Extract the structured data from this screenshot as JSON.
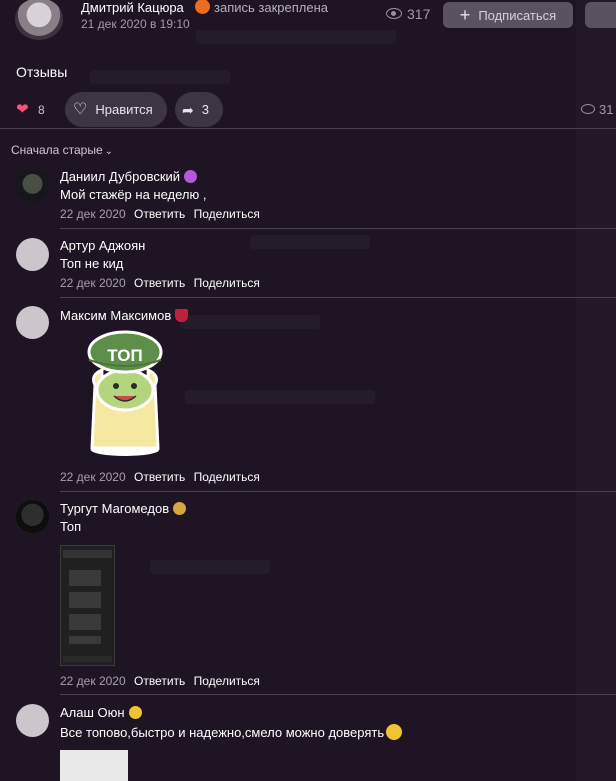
{
  "header": {
    "author_name": "Дмитрий Кацюра",
    "pinned_text": "запись закреплена",
    "date": "21 дек 2020 в 19:10",
    "views": "317",
    "subscribe_label": "Подписаться"
  },
  "post": {
    "text": "Отзывы",
    "likes": "8",
    "like_label": "Нравится",
    "shares": "3",
    "views": "31"
  },
  "sort_label": "Сначала старые",
  "comments": [
    {
      "name": "Даниил Дубровский",
      "badge": "purple-orb-icon",
      "text": "Мой стажёр на неделю ,",
      "date": "22 дек 2020",
      "reply": "Ответить",
      "share": "Поделиться"
    },
    {
      "name": "Артур Аджоян",
      "text": "Топ не кид",
      "date": "22 дек 2020",
      "reply": "Ответить",
      "share": "Поделиться"
    },
    {
      "name": "Максим Максимов",
      "badge": "wine-glass-icon",
      "sticker_text": "ТОП",
      "date": "22 дек 2020",
      "reply": "Ответить",
      "share": "Поделиться"
    },
    {
      "name": "Тургут Магомедов",
      "badge": "money-bag-icon",
      "text": "Топ",
      "date": "22 дек 2020",
      "reply": "Ответить",
      "share": "Поделиться"
    },
    {
      "name": "Алаш Оюн",
      "badge": "cowboy-emoji-icon",
      "text": "Все топово,быстро и надежно,смело можно доверять",
      "badge2": "sunglasses-emoji-icon"
    }
  ],
  "colors": {
    "background": "#1e1424",
    "button_bg": "#3e3544",
    "heart": "#ff4f7a",
    "muted_text": "#a8a0ad"
  }
}
